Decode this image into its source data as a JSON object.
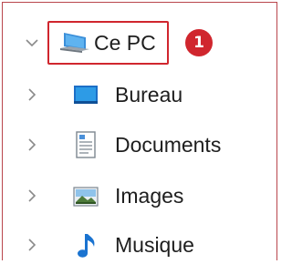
{
  "tree": {
    "root": {
      "label": "Ce PC",
      "icon": "computer-icon",
      "expanded": true
    },
    "children": [
      {
        "label": "Bureau",
        "icon": "desktop-folder-icon"
      },
      {
        "label": "Documents",
        "icon": "documents-folder-icon"
      },
      {
        "label": "Images",
        "icon": "pictures-folder-icon"
      },
      {
        "label": "Musique",
        "icon": "music-folder-icon"
      }
    ]
  },
  "annotation": {
    "badge": "1",
    "color": "#d0262e"
  }
}
